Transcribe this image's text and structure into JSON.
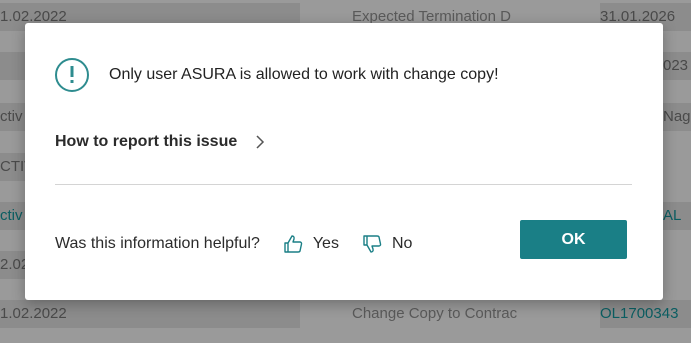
{
  "background": {
    "left_col": [
      "1.02.2022",
      "",
      "ctiv",
      "CTIV",
      "ctiv",
      "2.02",
      "1.02.2022"
    ],
    "mid_col": [
      "Expected Termination D",
      "",
      "",
      "",
      "",
      "",
      "Change Copy to Contrac"
    ],
    "right_col": [
      "31.01.2026",
      "023",
      "Nag",
      "",
      "AL",
      "",
      "OL1700343"
    ]
  },
  "dialog": {
    "message": "Only user ASURA is allowed to work with change copy!",
    "report_link": "How to report this issue",
    "feedback_question": "Was this information helpful?",
    "yes_label": "Yes",
    "no_label": "No",
    "ok_label": "OK",
    "icons": {
      "info": "info-circle-icon",
      "chevron": "chevron-right-icon",
      "thumbs_up": "thumbs-up-icon",
      "thumbs_down": "thumbs-down-icon"
    },
    "accent_color": "#1a7f86"
  }
}
